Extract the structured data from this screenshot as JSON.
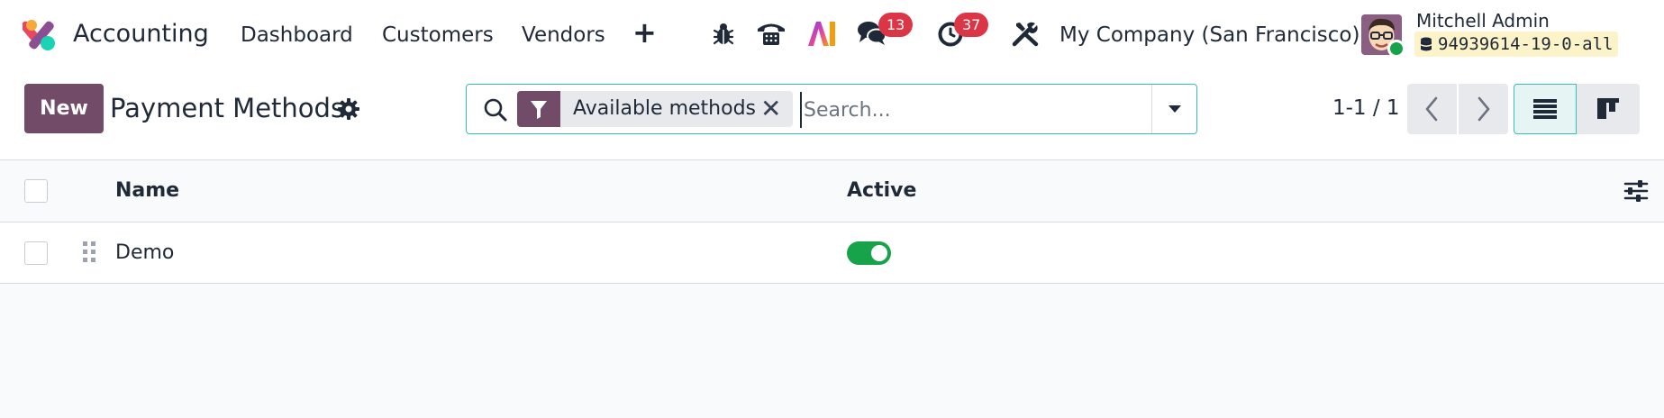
{
  "navbar": {
    "app_name": "Accounting",
    "menus": [
      "Dashboard",
      "Customers",
      "Vendors"
    ],
    "plus_symbol": "+",
    "icons": [
      "debug-icon",
      "phone-icon",
      "ai-icon",
      "chat-icon",
      "activity-clock-icon",
      "tools-icon"
    ],
    "messages_count": "13",
    "activities_count": "37",
    "company": "My Company (San Francisco)",
    "user_name": "Mitchell Admin",
    "database": "94939614-19-0-all"
  },
  "control_panel": {
    "new_label": "New",
    "title": "Payment Methods",
    "search": {
      "facet_label": "Available methods",
      "close_symbol": "✕",
      "placeholder": "Search..."
    },
    "pager": "1-1 / 1"
  },
  "list": {
    "columns": [
      "Name",
      "Active"
    ],
    "rows": [
      {
        "name": "Demo",
        "active": true
      }
    ]
  },
  "colors": {
    "brand": "#714b67",
    "accent_teal": "#36c0b6",
    "toggle_on": "#16a34a",
    "badge": "#dc3545"
  }
}
